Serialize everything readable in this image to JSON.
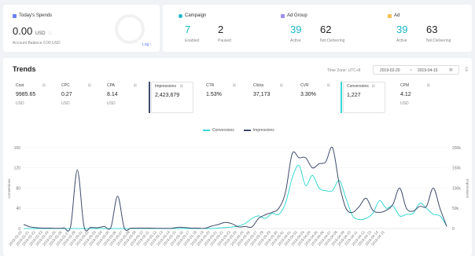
{
  "summary": {
    "spends": {
      "title": "Today's Spends",
      "value": "0.00",
      "unit": "USD",
      "balance": "Account Balance 0.00 USD",
      "link": "Log",
      "color": "#6c7ff3"
    },
    "campaign": {
      "title": "Campaign",
      "v1": "7",
      "l1": "Enabled",
      "v2": "2",
      "l2": "Paused",
      "color": "#1ab6c9"
    },
    "adgroup": {
      "title": "Ad Group",
      "v1": "39",
      "l1": "Active",
      "v2": "62",
      "l2": "Not Delivering",
      "color": "#9b8ff0"
    },
    "ad": {
      "title": "Ad",
      "v1": "39",
      "l1": "Active",
      "v2": "63",
      "l2": "Not Delivering",
      "color": "#f4c154"
    }
  },
  "trends": {
    "title": "Trends",
    "timezone": "Time Zone: UTC+8",
    "start": "2019-02-20",
    "sep": "~",
    "end": "2019-04-15",
    "metrics": [
      {
        "label": "Cost",
        "value": "9985.65",
        "unit": "USD"
      },
      {
        "label": "CPC",
        "value": "0.27",
        "unit": "USD"
      },
      {
        "label": "CPA",
        "value": "8.14",
        "unit": "USD"
      },
      {
        "label": "Impressions",
        "value": "2,423,679",
        "unit": ""
      },
      {
        "label": "CTR",
        "value": "1.53%",
        "unit": ""
      },
      {
        "label": "Clicks",
        "value": "37,173",
        "unit": ""
      },
      {
        "label": "CVR",
        "value": "3.30%",
        "unit": ""
      },
      {
        "label": "Conversions",
        "value": "1,227",
        "unit": ""
      },
      {
        "label": "CPM",
        "value": "4.12",
        "unit": "USD"
      }
    ]
  },
  "chart_data": {
    "type": "line",
    "ylabel_left": "Conversions",
    "ylabel_right": "Impressions",
    "y_left_ticks": [
      "0",
      "40",
      "80",
      "120",
      "160"
    ],
    "y_right_ticks": [
      "0",
      "50k",
      "100k",
      "150k",
      "200k"
    ],
    "ylim_left": [
      0,
      160
    ],
    "ylim_right": [
      0,
      200000
    ],
    "legend_position": "top-center",
    "x": [
      "2019-02-20",
      "2019-02-21",
      "2019-02-22",
      "2019-02-23",
      "2019-02-24",
      "2019-02-25",
      "2019-02-26",
      "2019-02-27",
      "2019-02-28",
      "2019-03-01",
      "2019-03-02",
      "2019-03-03",
      "2019-03-04",
      "2019-03-05",
      "2019-03-06",
      "2019-03-07",
      "2019-03-08",
      "2019-03-09",
      "2019-03-10",
      "2019-03-11",
      "2019-03-12",
      "2019-03-13",
      "2019-03-14",
      "2019-03-15",
      "2019-03-16",
      "2019-03-17",
      "2019-03-18",
      "2019-03-19",
      "2019-03-20",
      "2019-03-21",
      "2019-03-22",
      "2019-03-23",
      "2019-03-24",
      "2019-03-25",
      "2019-03-26",
      "2019-03-27",
      "2019-03-28",
      "2019-03-29",
      "2019-03-30",
      "2019-03-31",
      "2019-04-01",
      "2019-04-02",
      "2019-04-03",
      "2019-04-04",
      "2019-04-05",
      "2019-04-06",
      "2019-04-07",
      "2019-04-08",
      "2019-04-09",
      "2019-04-10",
      "2019-04-11",
      "2019-04-12",
      "2019-04-13",
      "2019-04-14",
      "2019-04-15"
    ],
    "series": [
      {
        "name": "Conversions",
        "axis": "left",
        "color": "#38d7d3",
        "values": [
          0,
          0,
          0,
          0,
          0,
          0,
          0,
          0,
          0,
          0,
          0,
          0,
          0,
          0,
          0,
          0,
          0,
          0,
          0,
          0,
          0,
          0,
          0,
          0,
          0,
          0,
          0,
          0,
          0,
          1,
          2,
          3,
          5,
          10,
          20,
          25,
          20,
          30,
          28,
          50,
          100,
          125,
          85,
          105,
          80,
          75,
          75,
          95,
          60,
          25,
          18,
          20,
          30,
          55,
          40,
          45,
          25,
          28,
          30,
          50,
          40,
          28,
          25,
          5
        ]
      },
      {
        "name": "Impressions",
        "axis": "right",
        "color": "#3f4b6b",
        "values": [
          10000,
          4000,
          2000,
          1000,
          1000,
          500,
          1500,
          5000,
          145000,
          5000,
          3000,
          2000,
          5000,
          3000,
          80000,
          1000,
          1000,
          1000,
          1000,
          1000,
          500,
          500,
          500,
          3000,
          2500,
          1000,
          1000,
          500,
          6000,
          10000,
          15000,
          12000,
          4000,
          5000,
          4000,
          25000,
          34000,
          40000,
          50000,
          90000,
          185000,
          175000,
          175000,
          150000,
          160000,
          165000,
          200000,
          110000,
          50000,
          40000,
          55000,
          75000,
          45000,
          40000,
          45000,
          60000,
          100000,
          50000,
          43000,
          55000,
          55000,
          100000,
          50000,
          5000
        ]
      }
    ]
  }
}
